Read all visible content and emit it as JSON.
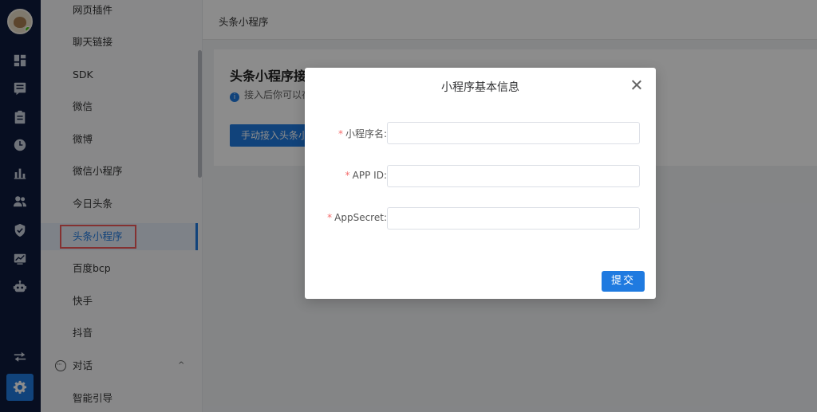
{
  "sidebar": {
    "items": [
      {
        "label": "网页插件"
      },
      {
        "label": "聊天链接"
      },
      {
        "label": "SDK"
      },
      {
        "label": "微信"
      },
      {
        "label": "微博"
      },
      {
        "label": "微信小程序"
      },
      {
        "label": "今日头条"
      },
      {
        "label": "头条小程序",
        "active": true
      },
      {
        "label": "百度bcp"
      },
      {
        "label": "快手"
      },
      {
        "label": "抖音"
      }
    ],
    "group": {
      "label": "对话",
      "chevron": "^"
    },
    "sub_items": [
      {
        "label": "智能引导"
      }
    ]
  },
  "header": {
    "breadcrumb": "头条小程序"
  },
  "card": {
    "title": "头条小程序接入",
    "info": "接入后你可以在",
    "button_label": "手动接入头条小"
  },
  "modal": {
    "title": "小程序基本信息",
    "fields": [
      {
        "label": "小程序名",
        "value": "",
        "required": true
      },
      {
        "label": "APP ID",
        "value": "",
        "required": true
      },
      {
        "label": "AppSecret",
        "value": "",
        "required": true
      }
    ],
    "submit_label": "提交"
  },
  "icons": [
    "dashboard-icon",
    "list-icon",
    "clipboard-icon",
    "clock-icon",
    "bar-chart-icon",
    "users-icon",
    "shield-icon",
    "monitor-chart-icon",
    "robot-icon",
    "swap-icon",
    "gear-icon"
  ],
  "colors": {
    "accent": "#1f7ae0",
    "rail": "#0e1a3d",
    "required": "#f56c6c",
    "highlight": "#f05a5a"
  }
}
